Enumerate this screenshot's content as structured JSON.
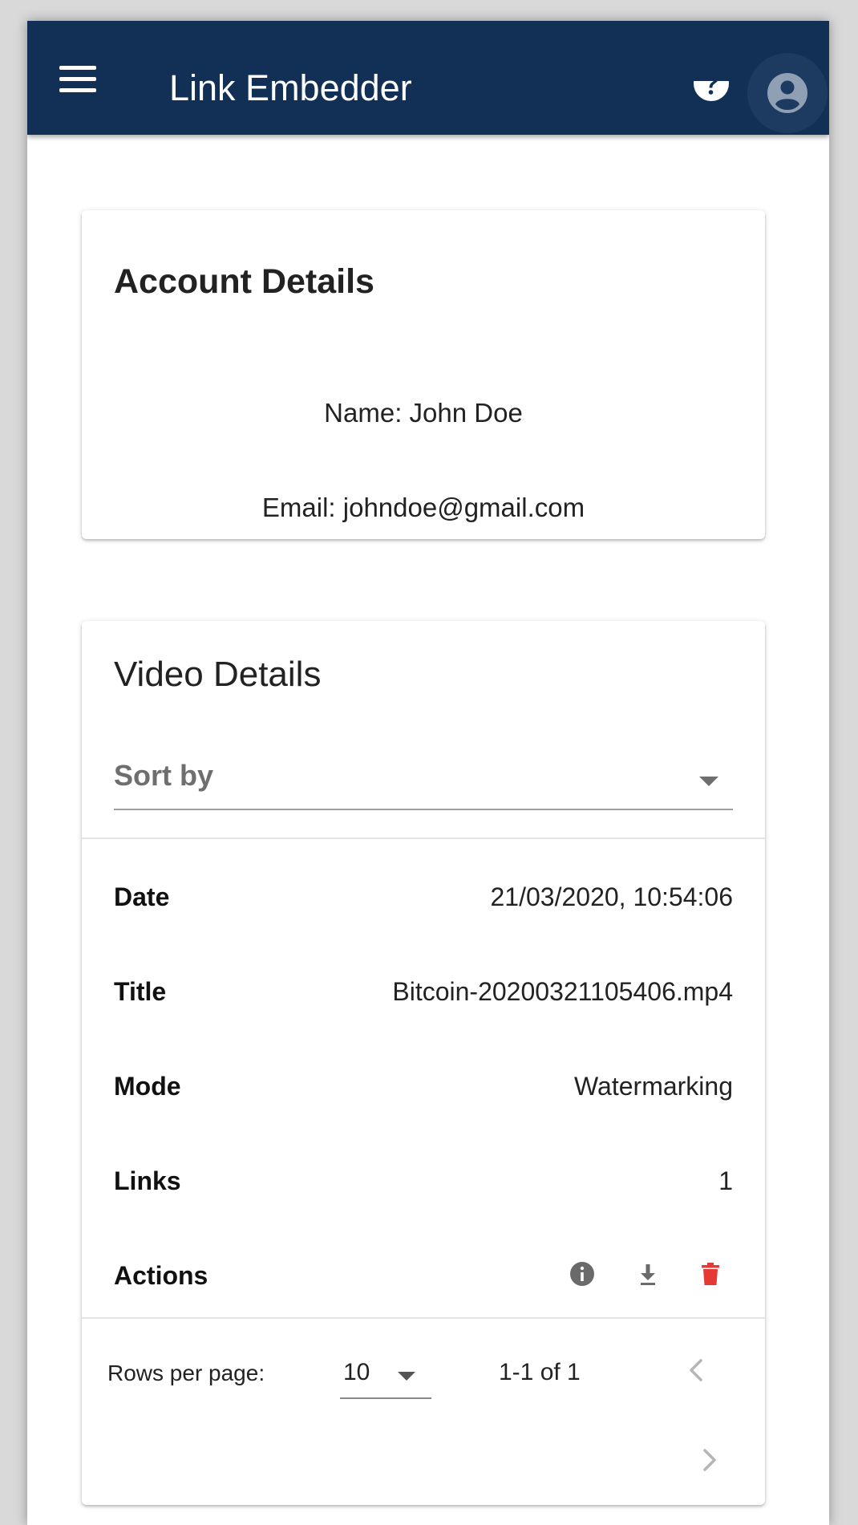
{
  "app": {
    "title": "Link Embedder",
    "icons": [
      "menu-icon",
      "help-icon",
      "account-icon"
    ],
    "colors": {
      "appbar": "#122f55",
      "delete": "#e53935",
      "muted_icon": "#6a6a6a"
    }
  },
  "account_card": {
    "heading": "Account Details",
    "name_line": "Name: John Doe",
    "email_line": "Email: johndoe@gmail.com"
  },
  "video_card": {
    "heading": "Video Details",
    "sort": {
      "label": "Sort by"
    },
    "rows": [
      {
        "label": "Date",
        "value": "21/03/2020, 10:54:06"
      },
      {
        "label": "Title",
        "value": "Bitcoin-20200321105406.mp4"
      },
      {
        "label": "Mode",
        "value": "Watermarking"
      },
      {
        "label": "Links",
        "value": "1"
      },
      {
        "label": "Actions",
        "actions": [
          "info-icon",
          "download-icon",
          "delete-icon"
        ]
      }
    ],
    "pagination": {
      "rows_per_page_label": "Rows per page:",
      "rows_per_page_value": "10",
      "range": "1-1 of 1"
    }
  }
}
